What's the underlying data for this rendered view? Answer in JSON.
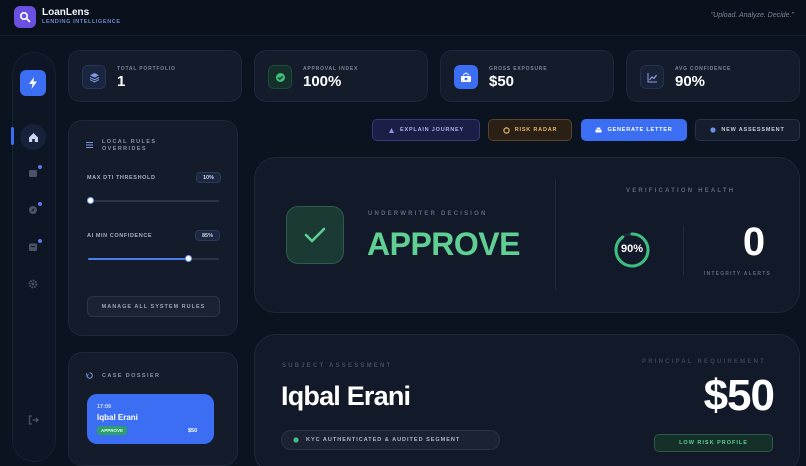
{
  "app": {
    "title": "LoanLens",
    "subtitle": "LENDING INTELLIGENCE",
    "tagline": "\"Upload. Analyze. Decide.\""
  },
  "kpis": [
    {
      "label": "TOTAL PORTFOLIO",
      "value": "1",
      "icon": "layers-icon",
      "color": "#7f9ae0"
    },
    {
      "label": "APPROVAL INDEX",
      "value": "100%",
      "icon": "check-circle-icon",
      "color": "#3fbf7f"
    },
    {
      "label": "GROSS EXPOSURE",
      "value": "$50",
      "icon": "money-icon",
      "color": "#3b6ef3"
    },
    {
      "label": "AVG CONFIDENCE",
      "value": "90%",
      "icon": "chart-icon",
      "color": "#8aa0d8"
    }
  ],
  "actions": {
    "explain": "EXPLAIN JOURNEY",
    "risk": "RISK RADAR",
    "letter": "GENERATE LETTER",
    "new": "NEW ASSESSMENT"
  },
  "rules": {
    "title_line1": "LOCAL RULES",
    "title_line2": "OVERRIDES",
    "dti_label": "MAX DTI THRESHOLD",
    "dti_value": "10%",
    "dti_fraction": 0.02,
    "ai_label": "AI MIN CONFIDENCE",
    "ai_value": "85%",
    "ai_fraction": 0.77,
    "manage_label": "MANAGE ALL SYSTEM RULES"
  },
  "decision": {
    "label": "UNDERWRITER DECISION",
    "value": "APPROVE",
    "health_label": "VERIFICATION HEALTH",
    "health_pct": "90%",
    "health_fraction": 0.9,
    "alerts_value": "0",
    "alerts_label": "INTEGRITY ALERTS"
  },
  "dossier": {
    "title": "CASE DOSSIER",
    "time": "17:09",
    "name": "Iqbal Erani",
    "status": "APPROVE",
    "amount": "$50"
  },
  "subject": {
    "label": "SUBJECT ASSESSMENT",
    "name": "Iqbal Erani",
    "kyc": "KYC AUTHENTICATED & AUDITED SEGMENT",
    "principal_label": "PRINCIPAL REQUIREMENT",
    "principal_value": "$50",
    "risk_profile": "LOW RISK PROFILE"
  },
  "colors": {
    "accent": "#3b6ef3",
    "approve": "#5fcf93",
    "background": "#0b1220"
  }
}
